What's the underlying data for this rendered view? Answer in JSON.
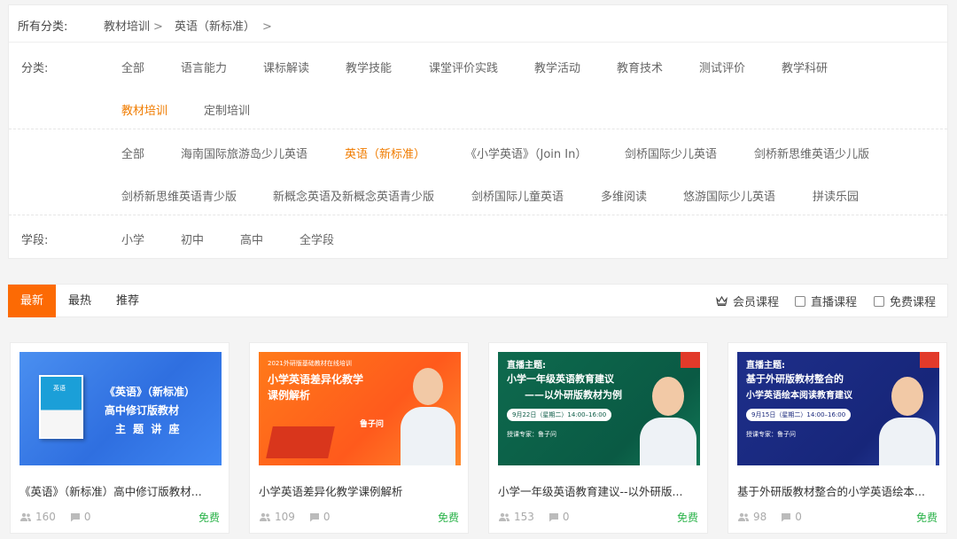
{
  "breadcrumb": {
    "label": "所有分类:",
    "items": [
      "教材培训",
      "英语（新标准）"
    ],
    "arrow": ">"
  },
  "category": {
    "label": "分类:",
    "row1": [
      "全部",
      "语言能力",
      "课标解读",
      "教学技能",
      "课堂评价实践",
      "教学活动",
      "教育技术",
      "测试评价",
      "教学科研"
    ],
    "row2": [
      "教材培训",
      "定制培训"
    ]
  },
  "subcategory": {
    "row1": [
      "全部",
      "海南国际旅游岛少儿英语",
      "英语（新标准）",
      "《小学英语》（Join In）",
      "剑桥国际少儿英语",
      "剑桥新思维英语少儿版"
    ],
    "row2": [
      "剑桥新思维英语青少版",
      "新概念英语及新概念英语青少版",
      "剑桥国际儿童英语",
      "多维阅读",
      "悠游国际少儿英语",
      "拼读乐园"
    ]
  },
  "stage": {
    "label": "学段:",
    "items": [
      "小学",
      "初中",
      "高中",
      "全学段"
    ]
  },
  "tabs": [
    "最新",
    "最热",
    "推荐"
  ],
  "filters": [
    "会员课程",
    "直播课程",
    "免费课程"
  ],
  "colors": {
    "accent": "#fc6a04",
    "active_text": "#f07c00",
    "free": "#2bb34a"
  },
  "cards": [
    {
      "title": "《英语》（新标准）高中修订版教材...",
      "views": "160",
      "comments": "0",
      "price": "免费",
      "thumb": {
        "book": "英语",
        "lines": [
          "《英语》（新标准）",
          "高中修订版教材",
          "主 题 讲 座"
        ]
      }
    },
    {
      "title": "小学英语差异化教学课例解析",
      "views": "109",
      "comments": "0",
      "price": "免费",
      "thumb": {
        "badge": "2021外研版基础教材在线培训",
        "lines": [
          "小学英语差异化教学",
          "课例解析"
        ],
        "speaker": "鲁子问"
      }
    },
    {
      "title": "小学一年级英语教育建议--以外研版...",
      "views": "153",
      "comments": "0",
      "price": "免费",
      "thumb": {
        "tag": "直播主题:",
        "lines": [
          "小学一年级英语教育建议",
          "——以外研版教材为例"
        ],
        "date": "9月22日（星期二）14:00–16:00",
        "expert": "授课专家：鲁子问"
      }
    },
    {
      "title": "基于外研版教材整合的小学英语绘本...",
      "views": "98",
      "comments": "0",
      "price": "免费",
      "thumb": {
        "tag": "直播主题:",
        "lines": [
          "基于外研版教材整合的",
          "小学英语绘本阅读教育建议"
        ],
        "date": "9月15日（星期二）14:00–16:00",
        "expert": "授课专家：鲁子问"
      }
    }
  ]
}
